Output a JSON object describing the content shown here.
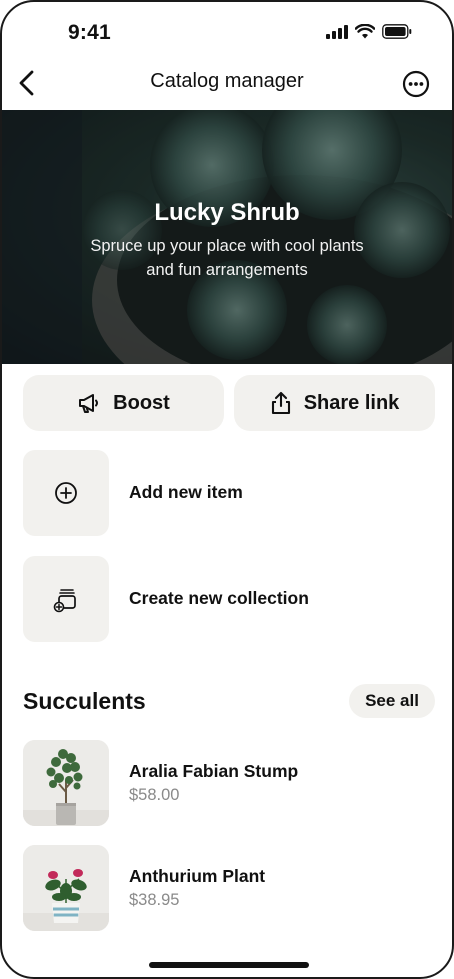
{
  "status_bar": {
    "time": "9:41",
    "icons": [
      "cellular-signal-icon",
      "wifi-icon",
      "battery-icon"
    ]
  },
  "header": {
    "title": "Catalog manager",
    "back_icon": "chevron-left-icon",
    "more_icon": "more-horizontal-icon"
  },
  "hero": {
    "title": "Lucky Shrub",
    "subtitle_line1": "Spruce up your place with cool plants",
    "subtitle_line2": "and fun arrangements"
  },
  "actions": {
    "boost_label": "Boost",
    "boost_icon": "megaphone-icon",
    "share_label": "Share link",
    "share_icon": "share-icon"
  },
  "quick_actions": [
    {
      "label": "Add new item",
      "icon": "plus-circle-icon"
    },
    {
      "label": "Create new collection",
      "icon": "add-collection-icon"
    }
  ],
  "section": {
    "title": "Succulents",
    "see_all_label": "See all"
  },
  "products": [
    {
      "name": "Aralia Fabian Stump",
      "price": "$58.00"
    },
    {
      "name": "Anthurium Plant",
      "price": "$38.95"
    }
  ],
  "colors": {
    "tile_background": "#f2f1ee",
    "price_text": "#8a8a8a",
    "text_primary": "#111111"
  }
}
